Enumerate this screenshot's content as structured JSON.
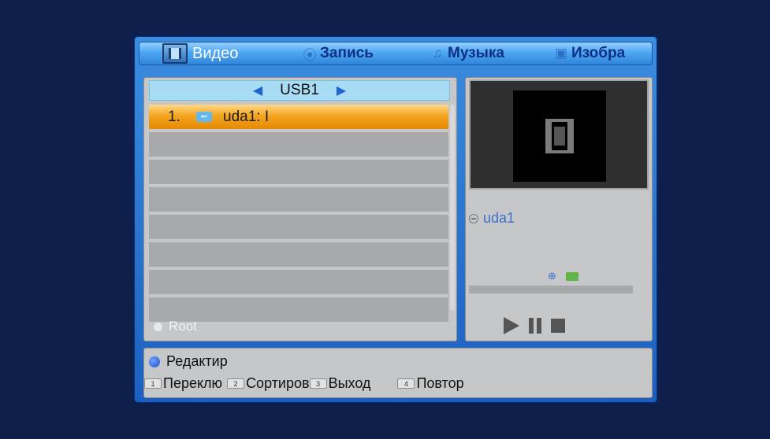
{
  "tabs": {
    "video": "Видео",
    "record": "Запись",
    "music": "Музыка",
    "photo": "Изобра"
  },
  "browser": {
    "device": "USB1",
    "rows": [
      {
        "num": "1.",
        "name": "uda1: I",
        "selected": true
      }
    ],
    "root_label": "Root"
  },
  "preview": {
    "device_name": "uda1"
  },
  "help": {
    "edit": "Редактир",
    "keys": [
      {
        "key": "1",
        "label": "Переклю"
      },
      {
        "key": "2",
        "label": "Сортиров"
      },
      {
        "key": "3",
        "label": "Выход"
      },
      {
        "key": "4",
        "label": "Повтор"
      }
    ]
  },
  "colors": {
    "background": "#0e1f4c",
    "panel": "#2d83d8",
    "selection": "#f3a51f",
    "accent_text": "#0d2f8a"
  },
  "icons": {
    "record": "disc-icon",
    "music": "music-note-icon",
    "photo": "photo-icon",
    "usb": "usb-icon"
  }
}
